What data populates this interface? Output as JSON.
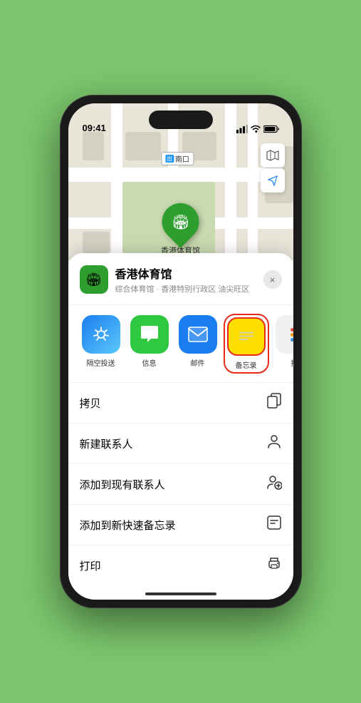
{
  "status_bar": {
    "time": "09:41",
    "time_arrow": "▶"
  },
  "map": {
    "label_icon_text": "出",
    "label_text": "南口",
    "stadium_name": "香港体育馆",
    "btn_map": "🗺",
    "btn_location": "➤"
  },
  "location_card": {
    "name": "香港体育馆",
    "description": "综合体育馆 · 香港特别行政区 油尖旺区",
    "close_label": "×"
  },
  "share_apps": [
    {
      "id": "airdrop",
      "label": "隔空投送",
      "icon": "📡"
    },
    {
      "id": "messages",
      "label": "信息",
      "icon": "💬"
    },
    {
      "id": "mail",
      "label": "邮件",
      "icon": "✉"
    },
    {
      "id": "notes",
      "label": "备忘录",
      "icon": "📝"
    },
    {
      "id": "more",
      "label": "推",
      "icon": "..."
    }
  ],
  "actions": [
    {
      "id": "copy",
      "label": "拷贝",
      "icon": "⧉"
    },
    {
      "id": "new-contact",
      "label": "新建联系人",
      "icon": "👤"
    },
    {
      "id": "add-existing",
      "label": "添加到现有联系人",
      "icon": "👤+"
    },
    {
      "id": "add-notes",
      "label": "添加到新快速备忘录",
      "icon": "📋"
    },
    {
      "id": "print",
      "label": "打印",
      "icon": "🖨"
    }
  ]
}
